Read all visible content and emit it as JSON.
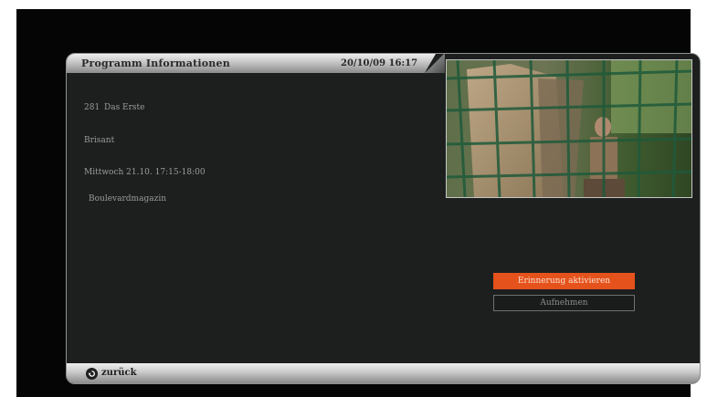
{
  "header": {
    "title": "Programm Informationen",
    "datetime": "20/10/09 16:17"
  },
  "program": {
    "channel_number": "281",
    "channel_name": "Das Erste",
    "show_title": "Brisant",
    "schedule": "Mittwoch 21.10.   17:15-18:00",
    "genre": "Boulevardmagazin"
  },
  "actions": {
    "reminder_label": "Erinnerung aktivieren",
    "record_label": "Aufnehmen"
  },
  "footer": {
    "back_label": "zurück"
  },
  "colors": {
    "accent": "#e5521b",
    "panel": "#1d1f1f",
    "text": "#9a9c9c"
  }
}
